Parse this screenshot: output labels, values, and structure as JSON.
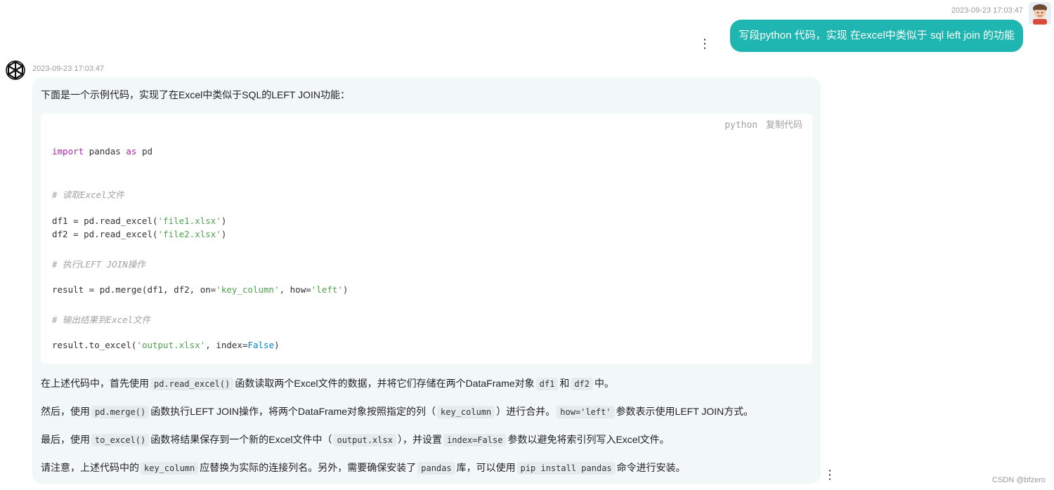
{
  "user_message": {
    "timestamp": "2023-09-23 17:03:47",
    "text": "写段python 代码，实现 在excel中类似于 sql left join 的功能",
    "menu_icon": "kebab-vertical-icon"
  },
  "bot_message": {
    "timestamp": "2023-09-23 17:03:47",
    "avatar_icon": "openai-logo-icon",
    "intro": "下面是一个示例代码，实现了在Excel中类似于SQL的LEFT JOIN功能：",
    "code": {
      "language": "python",
      "copy_label": "复制代码",
      "l1": {
        "a": "import",
        "b": " pandas ",
        "c": "as",
        "d": " pd"
      },
      "l2": "# 读取Excel文件",
      "l3": {
        "a": "df1 = pd.read_excel(",
        "b": "'file1.xlsx'",
        "c": ")"
      },
      "l4": {
        "a": "df2 = pd.read_excel(",
        "b": "'file2.xlsx'",
        "c": ")"
      },
      "l5": "# 执行LEFT JOIN操作",
      "l6": {
        "a": "result = pd.merge(df1, df2, on=",
        "b": "'key_column'",
        "c": ", how=",
        "d": "'left'",
        "e": ")"
      },
      "l7": "# 输出结果到Excel文件",
      "l8": {
        "a": "result.to_excel(",
        "b": "'output.xlsx'",
        "c": ", index=",
        "d": "False",
        "e": ")"
      }
    },
    "p1": {
      "a": "在上述代码中，首先使用",
      "c1": "pd.read_excel()",
      "b": "函数读取两个Excel文件的数据，并将它们存储在两个DataFrame对象",
      "c2": "df1",
      "c": "和",
      "c3": "df2",
      "d": "中。"
    },
    "p2": {
      "a": "然后，使用",
      "c1": "pd.merge()",
      "b": "函数执行LEFT JOIN操作，将两个DataFrame对象按照指定的列（",
      "c2": "key_column",
      "c": "）进行合并。",
      "c3": "how='left'",
      "d": "参数表示使用LEFT JOIN方式。"
    },
    "p3": {
      "a": "最后，使用",
      "c1": "to_excel()",
      "b": "函数将结果保存到一个新的Excel文件中（",
      "c2": "output.xlsx",
      "c": "），并设置",
      "c3": "index=False",
      "d": "参数以避免将索引列写入Excel文件。"
    },
    "p4": {
      "a": "请注意，上述代码中的",
      "c1": "key_column",
      "b": "应替换为实际的连接列名。另外，需要确保安装了",
      "c2": "pandas",
      "c": "库，可以使用",
      "c3": "pip install pandas",
      "d": "命令进行安装。"
    },
    "menu_icon": "kebab-vertical-icon"
  },
  "watermark": "CSDN @bfzero",
  "colors": {
    "user_bubble": "#1fb5b0",
    "bot_bubble": "#f2f7f7",
    "keyword": "#a626a4",
    "string": "#50a14f",
    "comment": "#a0a1a7"
  }
}
